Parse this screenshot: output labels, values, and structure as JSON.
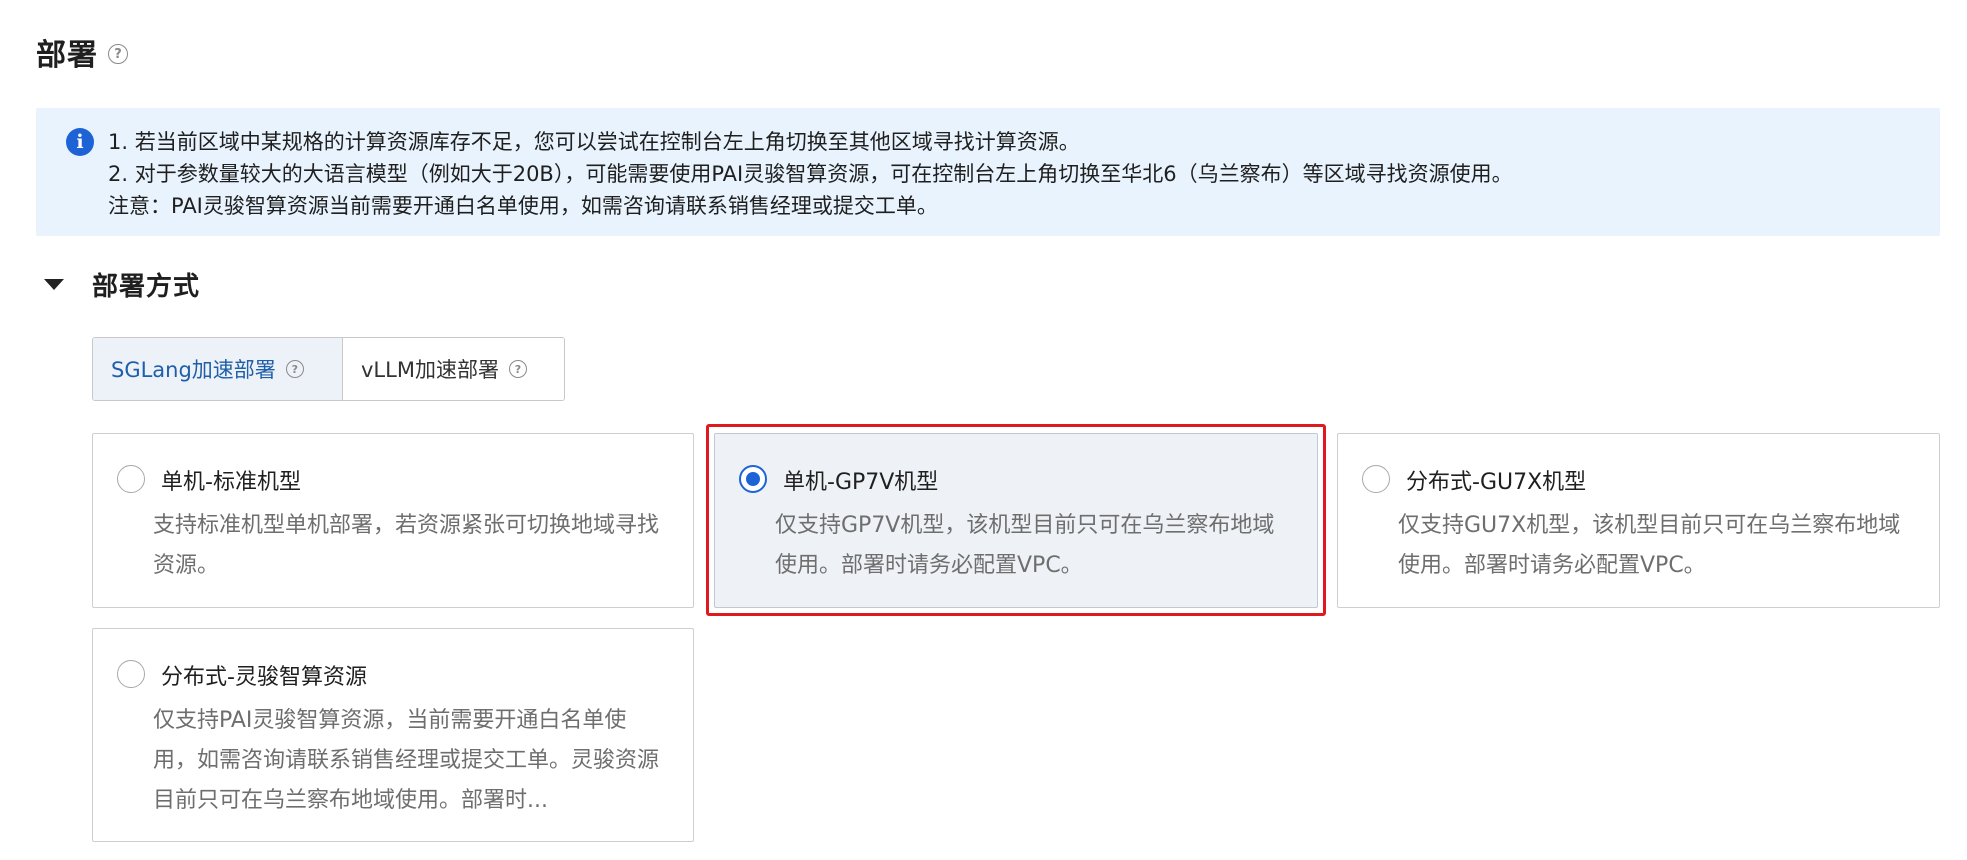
{
  "header": {
    "title": "部署",
    "help_icon": "question-circle-icon"
  },
  "info_banner": {
    "icon": "info-icon",
    "lines": [
      "1. 若当前区域中某规格的计算资源库存不足，您可以尝试在控制台左上角切换至其他区域寻找计算资源。",
      "2. 对于参数量较大的大语言模型（例如大于20B），可能需要使用PAI灵骏智算资源，可在控制台左上角切换至华北6（乌兰察布）等区域寻找资源使用。",
      "注意：PAI灵骏智算资源当前需要开通白名单使用，如需咨询请联系销售经理或提交工单。"
    ]
  },
  "deploy_section": {
    "title": "部署方式",
    "tabs": [
      {
        "label": "SGLang加速部署",
        "active": true
      },
      {
        "label": "vLLM加速部署",
        "active": false
      }
    ],
    "options": [
      {
        "title": "单机-标准机型",
        "desc": "支持标准机型单机部署，若资源紧张可切换地域寻找资源。",
        "selected": false
      },
      {
        "title": "单机-GP7V机型",
        "desc": "仅支持GP7V机型，该机型目前只可在乌兰察布地域使用。部署时请务必配置VPC。",
        "selected": true
      },
      {
        "title": "分布式-GU7X机型",
        "desc": "仅支持GU7X机型，该机型目前只可在乌兰察布地域使用。部署时请务必配置VPC。",
        "selected": false
      },
      {
        "title": "分布式-灵骏智算资源",
        "desc": "仅支持PAI灵骏智算资源，当前需要开通白名单使用，如需咨询请联系销售经理或提交工单。灵骏资源目前只可在乌兰察布地域使用。部署时...",
        "selected": false
      }
    ]
  },
  "colors": {
    "accent": "#1e63d6",
    "banner_bg": "#e8f3fd",
    "highlight": "#e0191f"
  }
}
